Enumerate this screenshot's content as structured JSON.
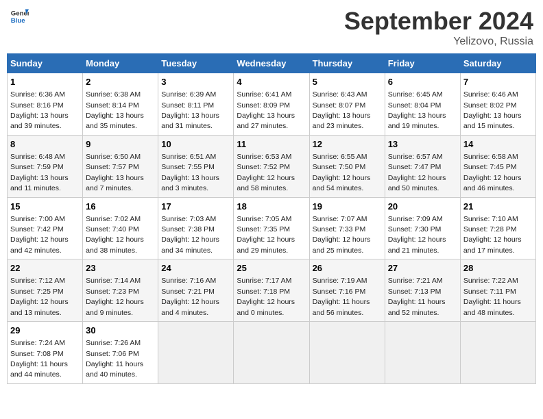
{
  "header": {
    "logo_general": "General",
    "logo_blue": "Blue",
    "title": "September 2024",
    "location": "Yelizovo, Russia"
  },
  "columns": [
    "Sunday",
    "Monday",
    "Tuesday",
    "Wednesday",
    "Thursday",
    "Friday",
    "Saturday"
  ],
  "weeks": [
    [
      {
        "day": "1",
        "info": "Sunrise: 6:36 AM\nSunset: 8:16 PM\nDaylight: 13 hours\nand 39 minutes."
      },
      {
        "day": "2",
        "info": "Sunrise: 6:38 AM\nSunset: 8:14 PM\nDaylight: 13 hours\nand 35 minutes."
      },
      {
        "day": "3",
        "info": "Sunrise: 6:39 AM\nSunset: 8:11 PM\nDaylight: 13 hours\nand 31 minutes."
      },
      {
        "day": "4",
        "info": "Sunrise: 6:41 AM\nSunset: 8:09 PM\nDaylight: 13 hours\nand 27 minutes."
      },
      {
        "day": "5",
        "info": "Sunrise: 6:43 AM\nSunset: 8:07 PM\nDaylight: 13 hours\nand 23 minutes."
      },
      {
        "day": "6",
        "info": "Sunrise: 6:45 AM\nSunset: 8:04 PM\nDaylight: 13 hours\nand 19 minutes."
      },
      {
        "day": "7",
        "info": "Sunrise: 6:46 AM\nSunset: 8:02 PM\nDaylight: 13 hours\nand 15 minutes."
      }
    ],
    [
      {
        "day": "8",
        "info": "Sunrise: 6:48 AM\nSunset: 7:59 PM\nDaylight: 13 hours\nand 11 minutes."
      },
      {
        "day": "9",
        "info": "Sunrise: 6:50 AM\nSunset: 7:57 PM\nDaylight: 13 hours\nand 7 minutes."
      },
      {
        "day": "10",
        "info": "Sunrise: 6:51 AM\nSunset: 7:55 PM\nDaylight: 13 hours\nand 3 minutes."
      },
      {
        "day": "11",
        "info": "Sunrise: 6:53 AM\nSunset: 7:52 PM\nDaylight: 12 hours\nand 58 minutes."
      },
      {
        "day": "12",
        "info": "Sunrise: 6:55 AM\nSunset: 7:50 PM\nDaylight: 12 hours\nand 54 minutes."
      },
      {
        "day": "13",
        "info": "Sunrise: 6:57 AM\nSunset: 7:47 PM\nDaylight: 12 hours\nand 50 minutes."
      },
      {
        "day": "14",
        "info": "Sunrise: 6:58 AM\nSunset: 7:45 PM\nDaylight: 12 hours\nand 46 minutes."
      }
    ],
    [
      {
        "day": "15",
        "info": "Sunrise: 7:00 AM\nSunset: 7:42 PM\nDaylight: 12 hours\nand 42 minutes."
      },
      {
        "day": "16",
        "info": "Sunrise: 7:02 AM\nSunset: 7:40 PM\nDaylight: 12 hours\nand 38 minutes."
      },
      {
        "day": "17",
        "info": "Sunrise: 7:03 AM\nSunset: 7:38 PM\nDaylight: 12 hours\nand 34 minutes."
      },
      {
        "day": "18",
        "info": "Sunrise: 7:05 AM\nSunset: 7:35 PM\nDaylight: 12 hours\nand 29 minutes."
      },
      {
        "day": "19",
        "info": "Sunrise: 7:07 AM\nSunset: 7:33 PM\nDaylight: 12 hours\nand 25 minutes."
      },
      {
        "day": "20",
        "info": "Sunrise: 7:09 AM\nSunset: 7:30 PM\nDaylight: 12 hours\nand 21 minutes."
      },
      {
        "day": "21",
        "info": "Sunrise: 7:10 AM\nSunset: 7:28 PM\nDaylight: 12 hours\nand 17 minutes."
      }
    ],
    [
      {
        "day": "22",
        "info": "Sunrise: 7:12 AM\nSunset: 7:25 PM\nDaylight: 12 hours\nand 13 minutes."
      },
      {
        "day": "23",
        "info": "Sunrise: 7:14 AM\nSunset: 7:23 PM\nDaylight: 12 hours\nand 9 minutes."
      },
      {
        "day": "24",
        "info": "Sunrise: 7:16 AM\nSunset: 7:21 PM\nDaylight: 12 hours\nand 4 minutes."
      },
      {
        "day": "25",
        "info": "Sunrise: 7:17 AM\nSunset: 7:18 PM\nDaylight: 12 hours\nand 0 minutes."
      },
      {
        "day": "26",
        "info": "Sunrise: 7:19 AM\nSunset: 7:16 PM\nDaylight: 11 hours\nand 56 minutes."
      },
      {
        "day": "27",
        "info": "Sunrise: 7:21 AM\nSunset: 7:13 PM\nDaylight: 11 hours\nand 52 minutes."
      },
      {
        "day": "28",
        "info": "Sunrise: 7:22 AM\nSunset: 7:11 PM\nDaylight: 11 hours\nand 48 minutes."
      }
    ],
    [
      {
        "day": "29",
        "info": "Sunrise: 7:24 AM\nSunset: 7:08 PM\nDaylight: 11 hours\nand 44 minutes."
      },
      {
        "day": "30",
        "info": "Sunrise: 7:26 AM\nSunset: 7:06 PM\nDaylight: 11 hours\nand 40 minutes."
      },
      {
        "day": "",
        "info": ""
      },
      {
        "day": "",
        "info": ""
      },
      {
        "day": "",
        "info": ""
      },
      {
        "day": "",
        "info": ""
      },
      {
        "day": "",
        "info": ""
      }
    ]
  ]
}
